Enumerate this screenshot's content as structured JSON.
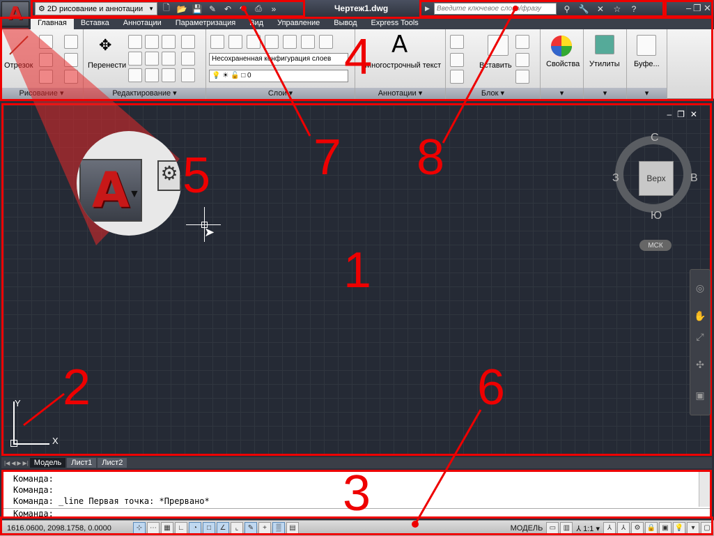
{
  "app": {
    "menu_letter": "A",
    "title": "Чертеж1.dwg"
  },
  "qat": {
    "workspace": "2D рисование и аннотации"
  },
  "search": {
    "placeholder": "Введите ключевое слово/фразу"
  },
  "tabs": [
    "Главная",
    "Вставка",
    "Аннотации",
    "Параметризация",
    "Вид",
    "Управление",
    "Вывод",
    "Express Tools"
  ],
  "ribbon": {
    "draw": {
      "title": "Рисование",
      "line_label": "Отрезок"
    },
    "modify": {
      "title": "Редактирование",
      "move_label": "Перенести"
    },
    "layers": {
      "title": "Слои",
      "layer_state": "Несохраненная конфигурация слоев",
      "current_layer": "0"
    },
    "annotation": {
      "title": "Аннотации",
      "mtext_label": "Многострочный текст",
      "mtext_glyph": "A"
    },
    "block": {
      "title": "Блок",
      "insert_label": "Вставить"
    },
    "properties": {
      "title": "Свойства"
    },
    "utilities": {
      "title": "Утилиты"
    },
    "clipboard": {
      "title": "Буфе..."
    }
  },
  "viewcube": {
    "top": "Верх",
    "north": "С",
    "south": "Ю",
    "west": "З",
    "east": "В",
    "ucs": "МСК"
  },
  "ucs_icon": {
    "x": "X",
    "y": "Y"
  },
  "magnifier_letter": "A",
  "callouts": [
    "1",
    "2",
    "3",
    "4",
    "5",
    "6",
    "7",
    "8"
  ],
  "layout_tabs": [
    "Модель",
    "Лист1",
    "Лист2"
  ],
  "command_lines": [
    "Команда:",
    "Команда:",
    "Команда: _line Первая точка: *Прервано*"
  ],
  "command_prompt": "Команда:",
  "status": {
    "coords": "1616.0600, 2098.1758, 0.0000",
    "model": "МОДЕЛЬ",
    "scale": "1:1"
  },
  "colors": {
    "frame": "#e00000",
    "canvas": "#252a35",
    "ribbon": "#e8e8e8"
  }
}
